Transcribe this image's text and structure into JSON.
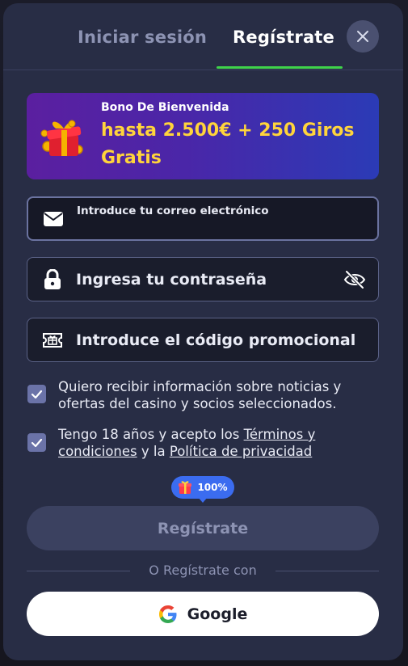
{
  "tabs": {
    "login_label": "Iniciar sesión",
    "register_label": "Regístrate",
    "active": "register"
  },
  "close": {
    "icon": "close-icon"
  },
  "bonus": {
    "subtitle": "Bono De Bienvenida",
    "title": "hasta 2.500€ + 250 Giros Gratis",
    "icon": "gift-box-icon"
  },
  "fields": {
    "email": {
      "label": "Introduce tu correo electrónico",
      "icon": "envelope-icon",
      "value": ""
    },
    "password": {
      "label": "Ingresa tu contraseña",
      "icon": "lock-icon",
      "toggle_icon": "eye-slash-icon",
      "value": ""
    },
    "promo": {
      "label": "Introduce el código promocional",
      "icon": "ticket-icon",
      "value": ""
    }
  },
  "consents": {
    "marketing": {
      "checked": true,
      "text": "Quiero recibir información sobre noticias y ofertas del casino y socios seleccionados."
    },
    "terms": {
      "checked": true,
      "text_1": "Tengo 18 años y acepto los ",
      "terms_link": "Términos y condiciones",
      "text_2": " y la ",
      "privacy_link": "Política de privacidad"
    }
  },
  "progress_badge": {
    "value": "100%",
    "icon": "gift-icon"
  },
  "submit": {
    "label": "Regístrate"
  },
  "divider": {
    "text": "O Regístrate con"
  },
  "social": {
    "google_label": "Google",
    "icon": "google-icon"
  },
  "colors": {
    "modal_bg": "#282d45",
    "accent_green": "#3fd34a",
    "bonus_gold": "#ffd43b",
    "badge_blue": "#3b6cf0"
  }
}
